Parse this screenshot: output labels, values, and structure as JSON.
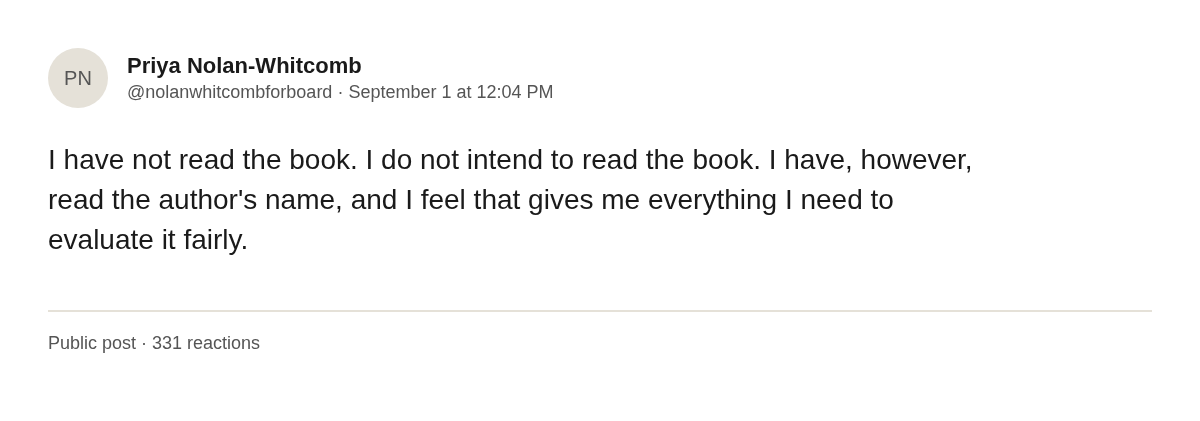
{
  "post": {
    "avatar_initials": "PN",
    "author": "Priya Nolan-Whitcomb",
    "meta": "@nolanwhitcombforboard · September 1 at 12:04 PM",
    "body": "I have not read the book. I do not intend to read the book. I have, however, read the author's name, and I feel that gives me everything I need to evaluate it fairly.",
    "footer": "Public post · 331 reactions"
  }
}
